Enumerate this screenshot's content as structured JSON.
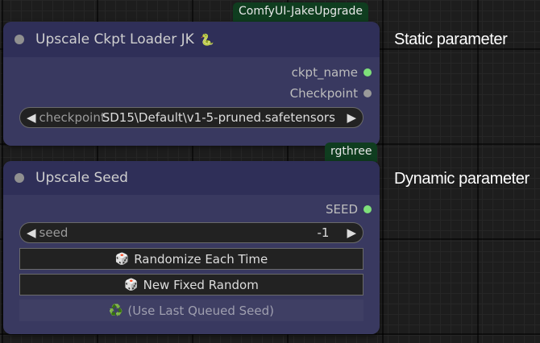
{
  "colors": {
    "badge_bg": "#0f3d1f",
    "node_header_bg": "#2f2f58",
    "node_body_bg": "#393960",
    "slot_connected": "#7ee07a",
    "slot_unconnected": "#9a9a9a"
  },
  "node1": {
    "source_badge": "ComfyUI-JakeUpgrade",
    "title": "Upscale Ckpt Loader JK",
    "title_icon": "snake-icon",
    "outputs": [
      {
        "label": "ckpt_name",
        "connected": true
      },
      {
        "label": "Checkpoint",
        "connected": false
      }
    ],
    "widget": {
      "label": "checkpoint",
      "value": "SD15\\Default\\v1-5-pruned.safetensors",
      "left_arrow": "◀",
      "right_arrow": "▶"
    }
  },
  "node2": {
    "source_badge": "rgthree",
    "title": "Upscale Seed",
    "outputs": [
      {
        "label": "SEED",
        "connected": true
      }
    ],
    "widget": {
      "label": "seed",
      "value": "-1",
      "left_arrow": "◀",
      "right_arrow": "▶"
    },
    "buttons": [
      {
        "icon": "🎲",
        "label": "Randomize Each Time"
      },
      {
        "icon": "🎲",
        "label": "New Fixed Random"
      },
      {
        "icon": "♻️",
        "label": "(Use Last Queued Seed)",
        "disabled": true
      }
    ]
  },
  "annotations": {
    "static": "Static parameter",
    "dynamic": "Dynamic parameter"
  }
}
